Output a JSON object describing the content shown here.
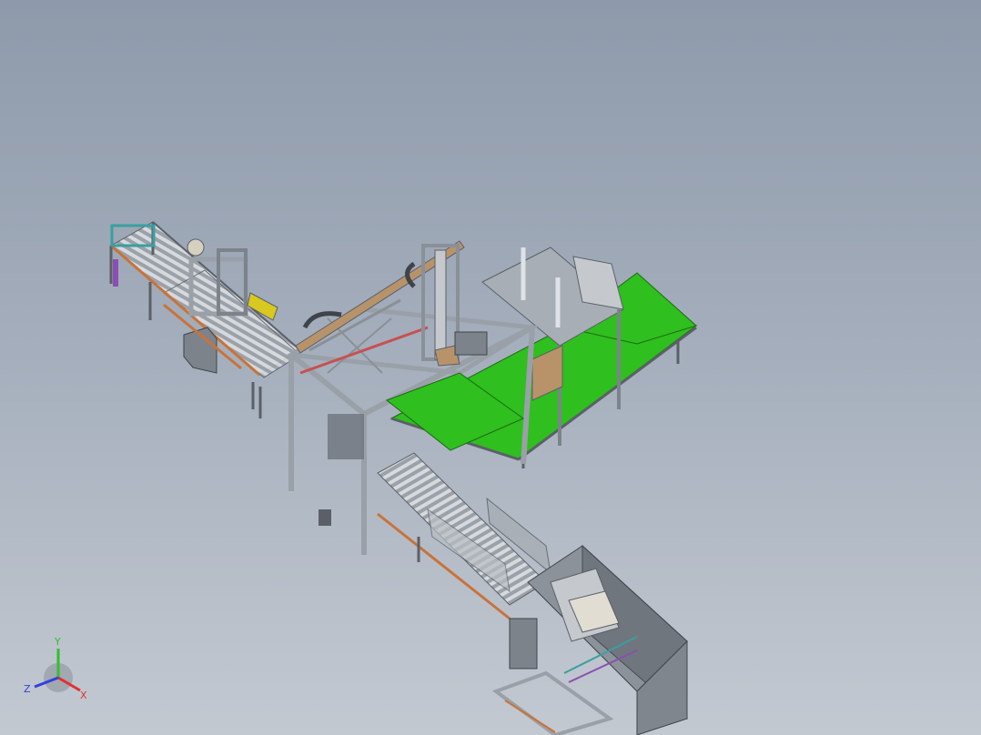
{
  "viewport": {
    "background_top": "#8e9aab",
    "background_bottom": "#c3c9d1",
    "colors": {
      "frame": "#9aa0a8",
      "frame_dark": "#5b6068",
      "roller": "#c9cdd2",
      "rail_orange": "#c8733a",
      "belt_green": "#2fbf1e",
      "panel": "#7d838b",
      "cardboard": "#b8936a",
      "accent_yellow": "#d8c820",
      "accent_purple": "#8a4fb0",
      "accent_teal": "#3a9fa0"
    }
  },
  "triad": {
    "x_label": "X",
    "y_label": "Y",
    "z_label": "Z",
    "x_color": "#e03030",
    "y_color": "#30c030",
    "z_color": "#3040e0"
  }
}
